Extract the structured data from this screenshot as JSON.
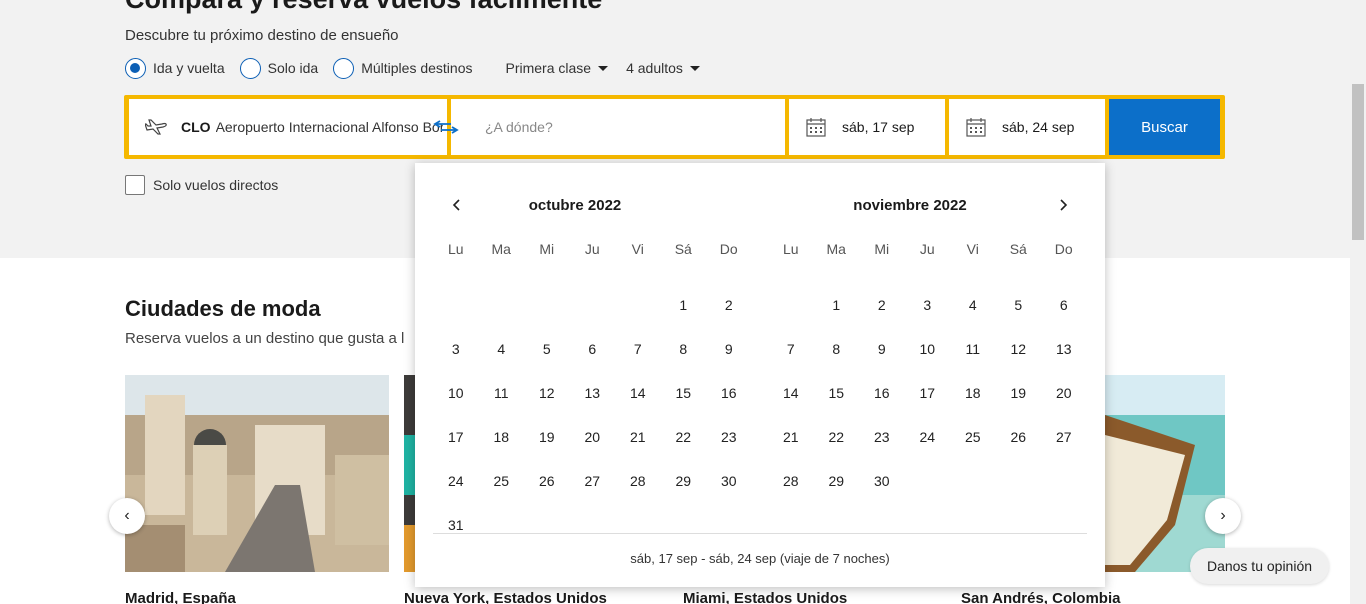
{
  "hero": {
    "title": "Compara y reserva vuelos fácilmente",
    "subtitle": "Descubre tu próximo destino de ensueño"
  },
  "trip_types": [
    {
      "label": "Ida y vuelta",
      "checked": true
    },
    {
      "label": "Solo ida",
      "checked": false
    },
    {
      "label": "Múltiples destinos",
      "checked": false
    }
  ],
  "cabin_class": "Primera clase",
  "passengers": "4 adultos",
  "search": {
    "origin_code": "CLO",
    "origin_name": "Aeropuerto Internacional Alfonso Bonilla Aragón",
    "destination_placeholder": "¿A dónde?",
    "depart_date": "sáb, 17 sep",
    "return_date": "sáb, 24 sep",
    "search_label": "Buscar"
  },
  "direct_only_label": "Solo vuelos directos",
  "calendar": {
    "weekdays": [
      "Lu",
      "Ma",
      "Mi",
      "Ju",
      "Vi",
      "Sá",
      "Do"
    ],
    "months": [
      {
        "title": "octubre 2022",
        "offset": 5,
        "days": 31
      },
      {
        "title": "noviembre 2022",
        "offset": 1,
        "days": 30
      }
    ],
    "footer": "sáb, 17 sep - sáb, 24 sep (viaje de 7 noches)"
  },
  "trending": {
    "title": "Ciudades de moda",
    "subtitle": "Reserva vuelos a un destino que gusta a l",
    "cities": [
      "Madrid, España",
      "Nueva York, Estados Unidos",
      "Miami, Estados Unidos",
      "San Andrés, Colombia"
    ]
  },
  "feedback_label": "Danos tu opinión",
  "colors": {
    "accent": "#0c6fc9",
    "highlight": "#f5b800"
  }
}
